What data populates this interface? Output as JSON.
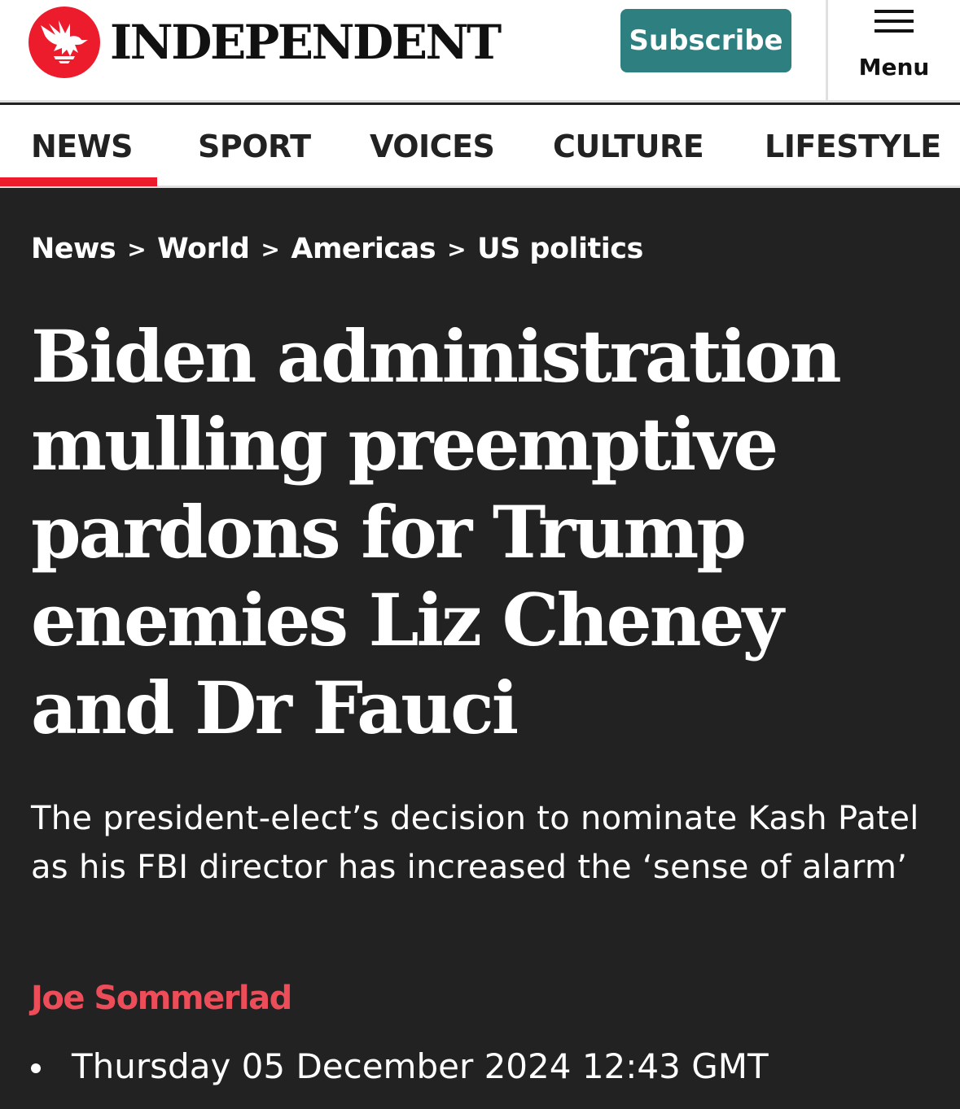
{
  "header": {
    "brand": "INDEPENDENT",
    "subscribe_label": "Subscribe",
    "menu_label": "Menu",
    "logo_icon": "eagle-icon",
    "brand_color": "#ec1c2d",
    "subscribe_color": "#2d7f80"
  },
  "nav": {
    "items": [
      {
        "label": "NEWS",
        "active": true
      },
      {
        "label": "SPORT",
        "active": false
      },
      {
        "label": "VOICES",
        "active": false
      },
      {
        "label": "CULTURE",
        "active": false
      },
      {
        "label": "LIFESTYLE",
        "active": false
      }
    ]
  },
  "breadcrumb": {
    "items": [
      "News",
      "World",
      "Americas",
      "US politics"
    ],
    "separator": ">"
  },
  "article": {
    "headline": "Biden administration mulling preemptive pardons for Trump enemies Liz Cheney and Dr Fauci",
    "standfirst": "The president-elect’s decision to nominate Kash Patel as his FBI director has increased the ‘sense of alarm’",
    "author": "Joe Sommerlad",
    "date": "Thursday 05 December 2024 12:43 GMT",
    "author_color": "#ec4d59",
    "background_color": "#222222"
  }
}
